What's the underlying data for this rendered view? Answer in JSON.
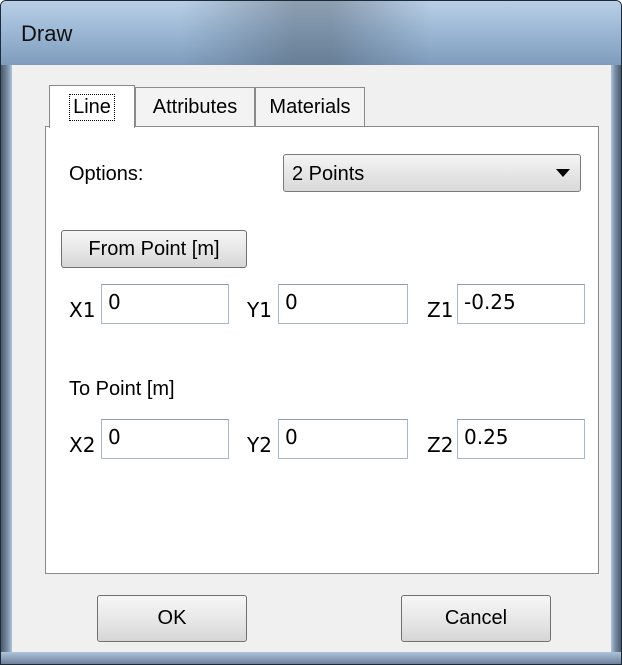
{
  "window": {
    "title": "Draw"
  },
  "tabs": [
    {
      "label": "Line",
      "active": true
    },
    {
      "label": "Attributes",
      "active": false
    },
    {
      "label": "Materials",
      "active": false
    }
  ],
  "options": {
    "label": "Options:",
    "selected": "2 Points"
  },
  "from_point": {
    "button_label": "From Point [m]",
    "x": {
      "label": "X1",
      "value": "0"
    },
    "y": {
      "label": "Y1",
      "value": "0"
    },
    "z": {
      "label": "Z1",
      "value": "-0.25"
    }
  },
  "to_point": {
    "label": "To Point [m]",
    "x": {
      "label": "X2",
      "value": "0"
    },
    "y": {
      "label": "Y2",
      "value": "0"
    },
    "z": {
      "label": "Z2",
      "value": "0.25"
    }
  },
  "buttons": {
    "ok": "OK",
    "cancel": "Cancel"
  },
  "icons": {
    "dropdown": "chevron-down-icon"
  }
}
